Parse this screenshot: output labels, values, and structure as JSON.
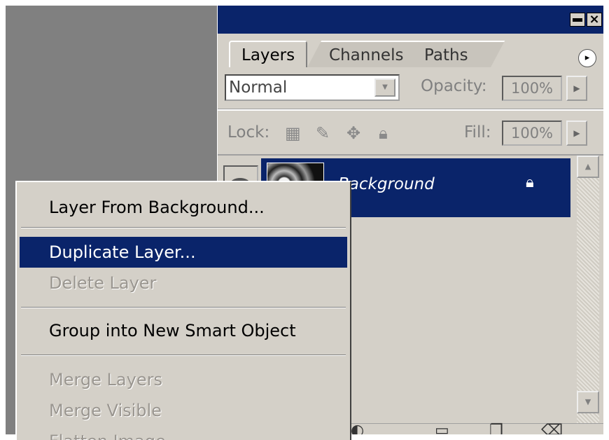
{
  "panel": {
    "tabs": [
      {
        "label": "Layers",
        "active": true
      },
      {
        "label": "Channels",
        "active": false
      },
      {
        "label": "Paths",
        "active": false
      }
    ],
    "close_glyph": "×",
    "menu_glyph": "▸",
    "blend_mode": "Normal",
    "opacity_label": "Opacity:",
    "opacity_value": "100%",
    "lock_label": "Lock:",
    "fill_label": "Fill:",
    "fill_value": "100%",
    "lock_icons": [
      "lock-transparent-icon",
      "brush-icon",
      "move-icon",
      "lock-all-icon"
    ],
    "layers": [
      {
        "name": "Background",
        "selected": true,
        "locked": true
      }
    ]
  },
  "context_menu": {
    "items": [
      {
        "label": "Layer From Background...",
        "state": "normal"
      },
      {
        "label": "Duplicate Layer...",
        "state": "highlighted"
      },
      {
        "label": "Delete Layer",
        "state": "disabled"
      },
      {
        "label": "Group into New Smart Object",
        "state": "normal"
      },
      {
        "label": "Merge Layers",
        "state": "disabled"
      },
      {
        "label": "Merge Visible",
        "state": "disabled"
      },
      {
        "label": "Flatten Image",
        "state": "disabled"
      }
    ]
  },
  "colors": {
    "title_bar": "#0a246a",
    "panel_bg": "#d4d0c8",
    "highlight": "#0a246a",
    "canvas": "#808080"
  }
}
